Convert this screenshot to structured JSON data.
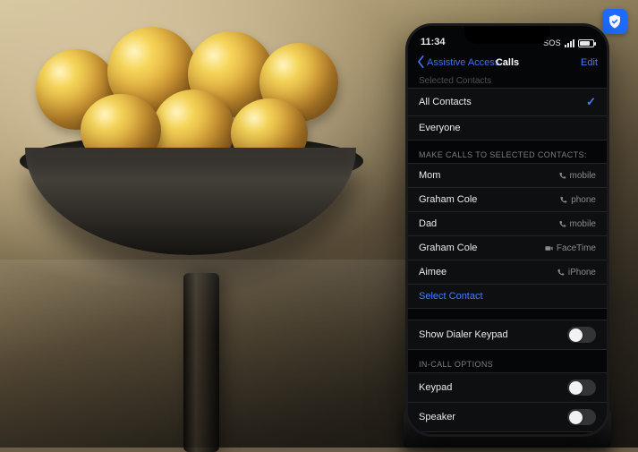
{
  "logo_name": "shield-check-logo",
  "status": {
    "time": "11:34",
    "sos": "SOS",
    "wifi": true,
    "battery_pct": 70
  },
  "nav": {
    "back_label": "Assistive Access",
    "title": "Calls",
    "edit": "Edit"
  },
  "partial_header": "Selected Contacts",
  "who_section": [
    {
      "label": "All Contacts",
      "checked": true
    },
    {
      "label": "Everyone",
      "checked": false
    }
  ],
  "make_calls_header": "MAKE CALLS TO SELECTED CONTACTS:",
  "contacts": [
    {
      "name": "Mom",
      "type": "mobile",
      "icon": "phone"
    },
    {
      "name": "Graham Cole",
      "type": "phone",
      "icon": "phone"
    },
    {
      "name": "Dad",
      "type": "mobile",
      "icon": "phone"
    },
    {
      "name": "Graham Cole",
      "type": "FaceTime",
      "icon": "facetime"
    },
    {
      "name": "Aimee",
      "type": "iPhone",
      "icon": "phone"
    }
  ],
  "select_contact": "Select Contact",
  "dialer": {
    "label": "Show Dialer Keypad",
    "on": false
  },
  "incall_header": "IN-CALL OPTIONS",
  "incall": [
    {
      "label": "Keypad",
      "on": false
    },
    {
      "label": "Speaker",
      "on": false
    }
  ]
}
